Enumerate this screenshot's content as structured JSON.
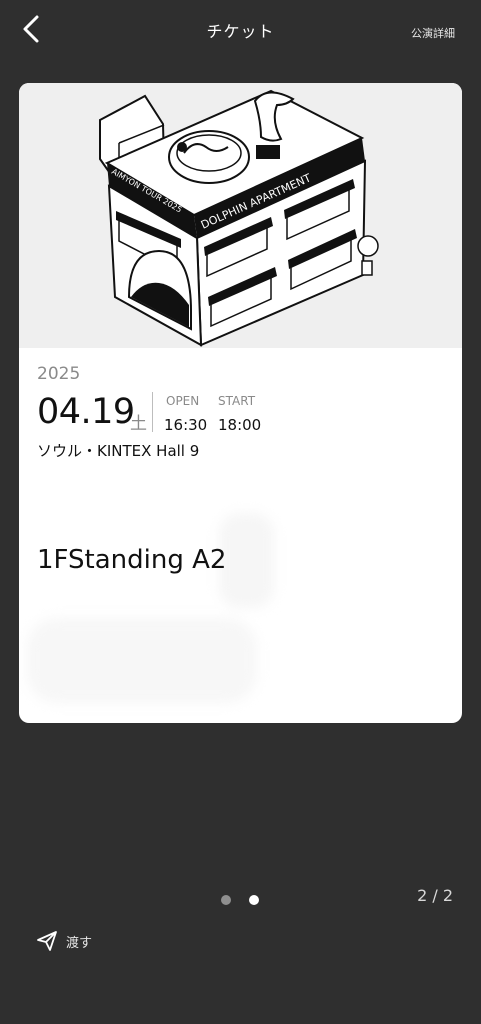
{
  "header": {
    "title": "チケット",
    "details_link": "公演詳細"
  },
  "ticket": {
    "artwork": {
      "building_sign": "DOLPHIN APARTMENT",
      "tour_text": "AIMYON TOUR 2025"
    },
    "year": "2025",
    "date": "04.19",
    "weekday": "土",
    "open_label": "OPEN",
    "open_time": "16:30",
    "start_label": "START",
    "start_time": "18:00",
    "venue": "ソウル・KINTEX Hall 9",
    "seat": "1FStanding A2"
  },
  "pager": {
    "count": "2 / 2",
    "total_pages": 2,
    "active_page": 2
  },
  "footer": {
    "transfer_label": "渡す"
  },
  "colors": {
    "background": "#2f2f2f",
    "card": "#ffffff"
  },
  "icons": [
    "back-icon",
    "send-icon"
  ]
}
